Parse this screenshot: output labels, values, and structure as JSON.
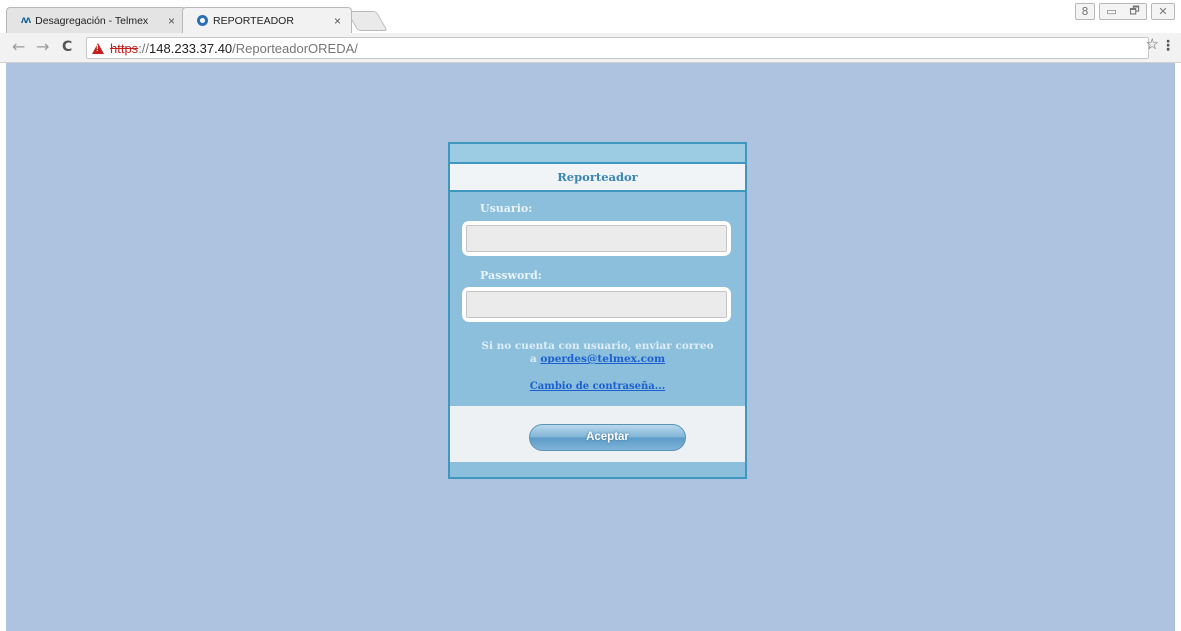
{
  "browser": {
    "tabs": [
      {
        "title": "Desagregación - Telmex",
        "icon": "telmex-icon",
        "active": false
      },
      {
        "title": "REPORTEADOR",
        "icon": "reporteador-icon",
        "active": true
      }
    ],
    "tab_close_glyph": "×",
    "address": {
      "scheme": "https",
      "separator": "://",
      "host": "148.233.37.40",
      "path": "/ReporteadorOREDA/",
      "security": "not-secure-warning-icon"
    },
    "nav": {
      "back": "←",
      "forward": "→",
      "reload": "C"
    },
    "bookmark_icon": "☆",
    "menu_icon": "⋮",
    "window_controls": {
      "user": "8",
      "minimize": "▭",
      "maximize": "🗗",
      "close": "✕"
    }
  },
  "login": {
    "header_title": "Reporteador",
    "username_label": "Usuario:",
    "username_value": "",
    "password_label": "Password:",
    "password_value": "",
    "info_line1": "Si no cuenta con usuario, enviar correo",
    "info_line2_prefix": "a ",
    "info_email": "operdes@telmex.com",
    "change_password_link": "Cambio de contraseña...",
    "submit_label": "Aceptar"
  },
  "colors": {
    "page_background": "#aec3df",
    "box_background": "#8bbfdb",
    "box_border": "#3f97c0",
    "header_text": "#3a86b5",
    "link": "#1b5fd0"
  }
}
